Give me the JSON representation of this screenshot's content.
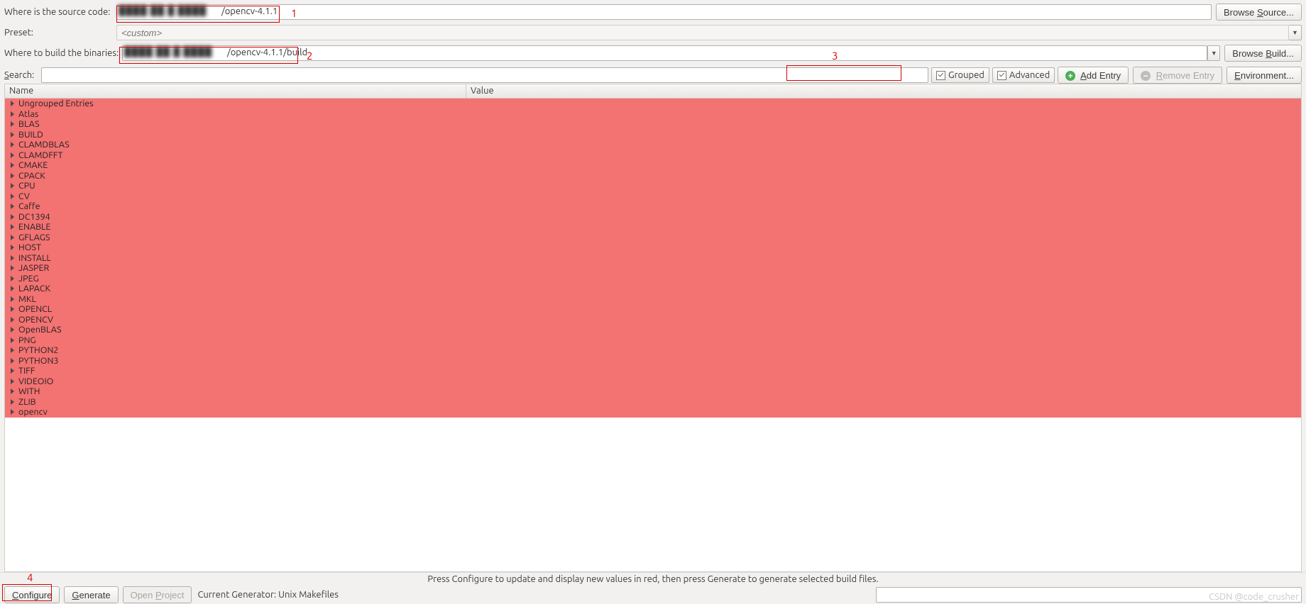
{
  "labels": {
    "source": "Where is the source code:",
    "preset": "Preset:",
    "build": "Where to build the binaries:",
    "search": "Search:",
    "browse_source": "Browse Source...",
    "browse_build": "Browse Build...",
    "grouped": "Grouped",
    "advanced": "Advanced",
    "add_entry": "Add Entry",
    "remove_entry": "Remove Entry",
    "environment": "Environment...",
    "name_col": "Name",
    "value_col": "Value",
    "configure": "Configure",
    "generate": "Generate",
    "open_project": "Open Project",
    "current_generator": "Current Generator: Unix Makefiles",
    "footer_msg": "Press Configure to update and display new values in red, then press Generate to generate selected build files.",
    "preset_placeholder": "<custom>",
    "watermark": "CSDN @code_crusher"
  },
  "paths": {
    "source_shown": "/opencv-4.1.1",
    "build_shown": "/opencv-4.1.1/build"
  },
  "checks": {
    "grouped": true,
    "advanced": true
  },
  "annotations": {
    "n1": "1",
    "n2": "2",
    "n3": "3",
    "n4": "4"
  },
  "groups": [
    "Ungrouped Entries",
    "Atlas",
    "BLAS",
    "BUILD",
    "CLAMDBLAS",
    "CLAMDFFT",
    "CMAKE",
    "CPACK",
    "CPU",
    "CV",
    "Caffe",
    "DC1394",
    "ENABLE",
    "GFLAGS",
    "HOST",
    "INSTALL",
    "JASPER",
    "JPEG",
    "LAPACK",
    "MKL",
    "OPENCL",
    "OPENCV",
    "OpenBLAS",
    "PNG",
    "PYTHON2",
    "PYTHON3",
    "TIFF",
    "VIDEOIO",
    "WITH",
    "ZLIB",
    "opencv"
  ],
  "colors": {
    "group_bg": "#f37272",
    "anno": "#d40000"
  }
}
